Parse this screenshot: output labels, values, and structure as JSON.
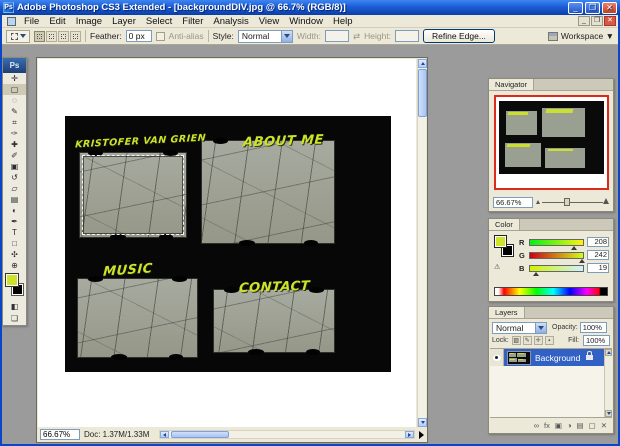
{
  "window": {
    "title": "Adobe Photoshop CS3 Extended - [backgroundDIV.jpg @ 66.7% (RGB/8)]",
    "logo": "Ps",
    "controls": {
      "minimize": "_",
      "maximize": "❐",
      "close": "✕"
    }
  },
  "menu": {
    "items": [
      "File",
      "Edit",
      "Image",
      "Layer",
      "Select",
      "Filter",
      "Analysis",
      "View",
      "Window",
      "Help"
    ]
  },
  "doc_controls": {
    "minimize": "_",
    "restore": "❐",
    "close": "✕"
  },
  "options": {
    "feather_label": "Feather:",
    "feather_value": "0 px",
    "anti_alias_label": "Anti-alias",
    "style_label": "Style:",
    "style_value": "Normal",
    "width_label": "Width:",
    "height_label": "Height:",
    "refine_edge_label": "Refine Edge...",
    "workspace_label": "Workspace ▼"
  },
  "toolbox": {
    "logo": "Ps",
    "foreground_color": "#cde32a",
    "background_color": "#000000",
    "tools": [
      {
        "name": "move-tool",
        "glyph": "✛"
      },
      {
        "name": "rectangular-marquee-tool",
        "glyph": "▢"
      },
      {
        "name": "lasso-tool",
        "glyph": "◌"
      },
      {
        "name": "quick-selection-tool",
        "glyph": "✎"
      },
      {
        "name": "crop-tool",
        "glyph": "⌗"
      },
      {
        "name": "eyedropper-tool",
        "glyph": "✑"
      },
      {
        "name": "healing-brush-tool",
        "glyph": "✚"
      },
      {
        "name": "brush-tool",
        "glyph": "✐"
      },
      {
        "name": "clone-stamp-tool",
        "glyph": "▣"
      },
      {
        "name": "history-brush-tool",
        "glyph": "↺"
      },
      {
        "name": "eraser-tool",
        "glyph": "▱"
      },
      {
        "name": "gradient-tool",
        "glyph": "▤"
      },
      {
        "name": "dodge-tool",
        "glyph": "◐"
      },
      {
        "name": "pen-tool",
        "glyph": "✒"
      },
      {
        "name": "type-tool",
        "glyph": "T"
      },
      {
        "name": "shape-tool",
        "glyph": "□"
      },
      {
        "name": "hand-tool",
        "glyph": "✣"
      },
      {
        "name": "zoom-tool",
        "glyph": "⊕"
      }
    ],
    "extras": [
      {
        "name": "quick-mask-mode",
        "glyph": "◧"
      },
      {
        "name": "screen-mode",
        "glyph": "❏"
      }
    ]
  },
  "canvas": {
    "text_color": "#cde32a",
    "tiles": [
      {
        "label": "KRISTOFER VAN GRIEN"
      },
      {
        "label": "ABOUT ME"
      },
      {
        "label": "MUSIC"
      },
      {
        "label": "CONTACT"
      }
    ]
  },
  "docbar": {
    "zoom": "66.67%",
    "doc_size": "Doc: 1.37M/1.33M"
  },
  "navigator": {
    "tab": "Navigator",
    "zoom": "66.67%"
  },
  "color": {
    "tab": "Color",
    "channels": [
      {
        "label": "R",
        "value": "208"
      },
      {
        "label": "G",
        "value": "242"
      },
      {
        "label": "B",
        "value": "19"
      }
    ],
    "warning_icon": "⚠"
  },
  "layers": {
    "tab": "Layers",
    "blend_mode": "Normal",
    "opacity_label": "Opacity:",
    "opacity_value": "100%",
    "lock_label": "Lock:",
    "lock_icons": [
      {
        "name": "lock-transparency-icon",
        "glyph": "▨"
      },
      {
        "name": "lock-image-icon",
        "glyph": "✎"
      },
      {
        "name": "lock-position-icon",
        "glyph": "✛"
      },
      {
        "name": "lock-all-icon",
        "glyph": "▪"
      }
    ],
    "fill_label": "Fill:",
    "fill_value": "100%",
    "rows": [
      {
        "name": "Background"
      }
    ],
    "buttons": [
      {
        "name": "link-layers-icon",
        "glyph": "∞"
      },
      {
        "name": "layer-style-icon",
        "glyph": "fx"
      },
      {
        "name": "add-mask-icon",
        "glyph": "▣"
      },
      {
        "name": "adjustment-layer-icon",
        "glyph": "◑"
      },
      {
        "name": "new-group-icon",
        "glyph": "▤"
      },
      {
        "name": "new-layer-icon",
        "glyph": "▢"
      },
      {
        "name": "delete-layer-icon",
        "glyph": "✕"
      }
    ]
  }
}
